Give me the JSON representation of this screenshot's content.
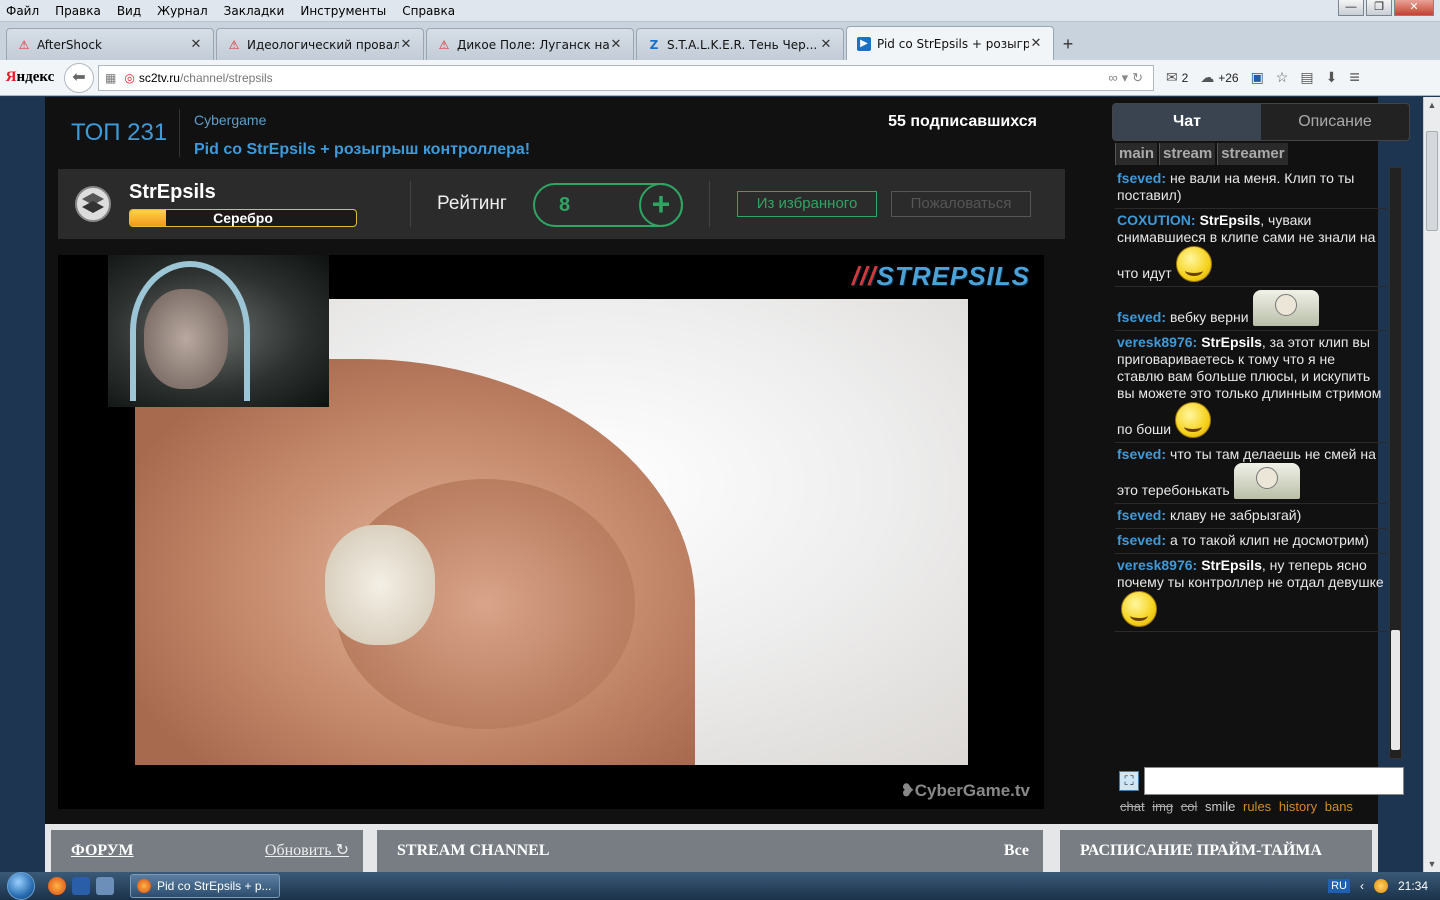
{
  "menu": [
    "Файл",
    "Правка",
    "Вид",
    "Журнал",
    "Закладки",
    "Инструменты",
    "Справка"
  ],
  "window_controls": [
    "—",
    "❐",
    "✕"
  ],
  "tabs": [
    {
      "label": "AfterShock",
      "icon": "warning-icon"
    },
    {
      "label": "Идеологический провал...",
      "icon": "warning-icon"
    },
    {
      "label": "Дикое Поле: Луганск на...",
      "icon": "warning-icon"
    },
    {
      "label": "S.T.A.L.K.E.R. Тень Чер...",
      "icon": "stalker-icon"
    },
    {
      "label": "Pid со StrEpsils + розыгр...",
      "icon": "sc2tv-icon",
      "active": true
    }
  ],
  "tab_close": "✕",
  "new_tab": "+",
  "navbar": {
    "brand_first": "Я",
    "brand_rest": "ндекс",
    "url_site": "sc2tv.ru",
    "url_path": "/channel/strepsils",
    "mail_count": "2",
    "weather": "+26"
  },
  "header": {
    "top_rank": "ТОП 231",
    "game": "Cybergame",
    "stream_title": "Pid со StrEpsils + розыгрыш контроллера!",
    "subscribers": "55 подписавшихся"
  },
  "profile": {
    "name": "StrEpsils",
    "rank_label": "Серебро",
    "rank_progress": 0.16,
    "rating_label": "Рейтинг",
    "rating_value": "8",
    "plus": "+",
    "fav_button": "Из избранного",
    "complain_button": "Пожаловаться"
  },
  "player": {
    "watermark_prefix": "///",
    "watermark": "STREPSILS",
    "cybergame_wm": "CyberGame.tv"
  },
  "chat": {
    "tab_chat": "Чат",
    "tab_description": "Описание",
    "subtabs": [
      "main",
      "stream",
      "streamer"
    ],
    "messages": [
      {
        "nick": "fseved:",
        "to": "",
        "text": "не вали на меня. Клип то ты поставил)",
        "emote": ""
      },
      {
        "nick": "COXUTION:",
        "to": "StrEpsils",
        "text": ", чуваки снимавшиеся в клипе сами не знали на что идут",
        "emote": "smile"
      },
      {
        "nick": "fseved:",
        "to": "",
        "text": "вебку верни",
        "emote": "meme"
      },
      {
        "nick": "veresk8976:",
        "to": "StrEpsils",
        "text": ", за этот клип вы приговариваетесь к тому что я не ставлю вам больше плюсы, и искупить вы можете это только длинным стримом по боши",
        "emote": "smile"
      },
      {
        "nick": "fseved:",
        "to": "",
        "text": "что ты там делаешь не смей на это теребонькать",
        "emote": "smile-meme"
      },
      {
        "nick": "fseved:",
        "to": "",
        "text": "клаву не забрызгай)",
        "emote": ""
      },
      {
        "nick": "fseved:",
        "to": "",
        "text": "а то такой клип не досмотрим)",
        "emote": ""
      },
      {
        "nick": "veresk8976:",
        "to": "StrEpsils",
        "text": ", ну теперь ясно почему ты контроллер не отдал девушке",
        "emote": "smile"
      }
    ],
    "links_strike": [
      "chat",
      "img",
      "col"
    ],
    "links_plain": [
      "smile"
    ],
    "links_color": [
      "rules",
      "history",
      "bans"
    ],
    "expand_icon": "⛶"
  },
  "bottom": {
    "forum": "ФОРУМ",
    "forum_refresh": "Обновить",
    "stream_channel": "STREAM CHANNEL",
    "all": "Все",
    "schedule": "РАСПИСАНИЕ ПРАЙМ-ТАЙМА"
  },
  "taskbar": {
    "task_label": "Pid со StrEpsils + p...",
    "lang": "RU",
    "clock": "21:34"
  },
  "colors": {
    "accent_blue": "#3d9bdb",
    "rating_green": "#2fa563",
    "link_orange": "#d6892a",
    "rank_gold": "#f09a1a"
  }
}
